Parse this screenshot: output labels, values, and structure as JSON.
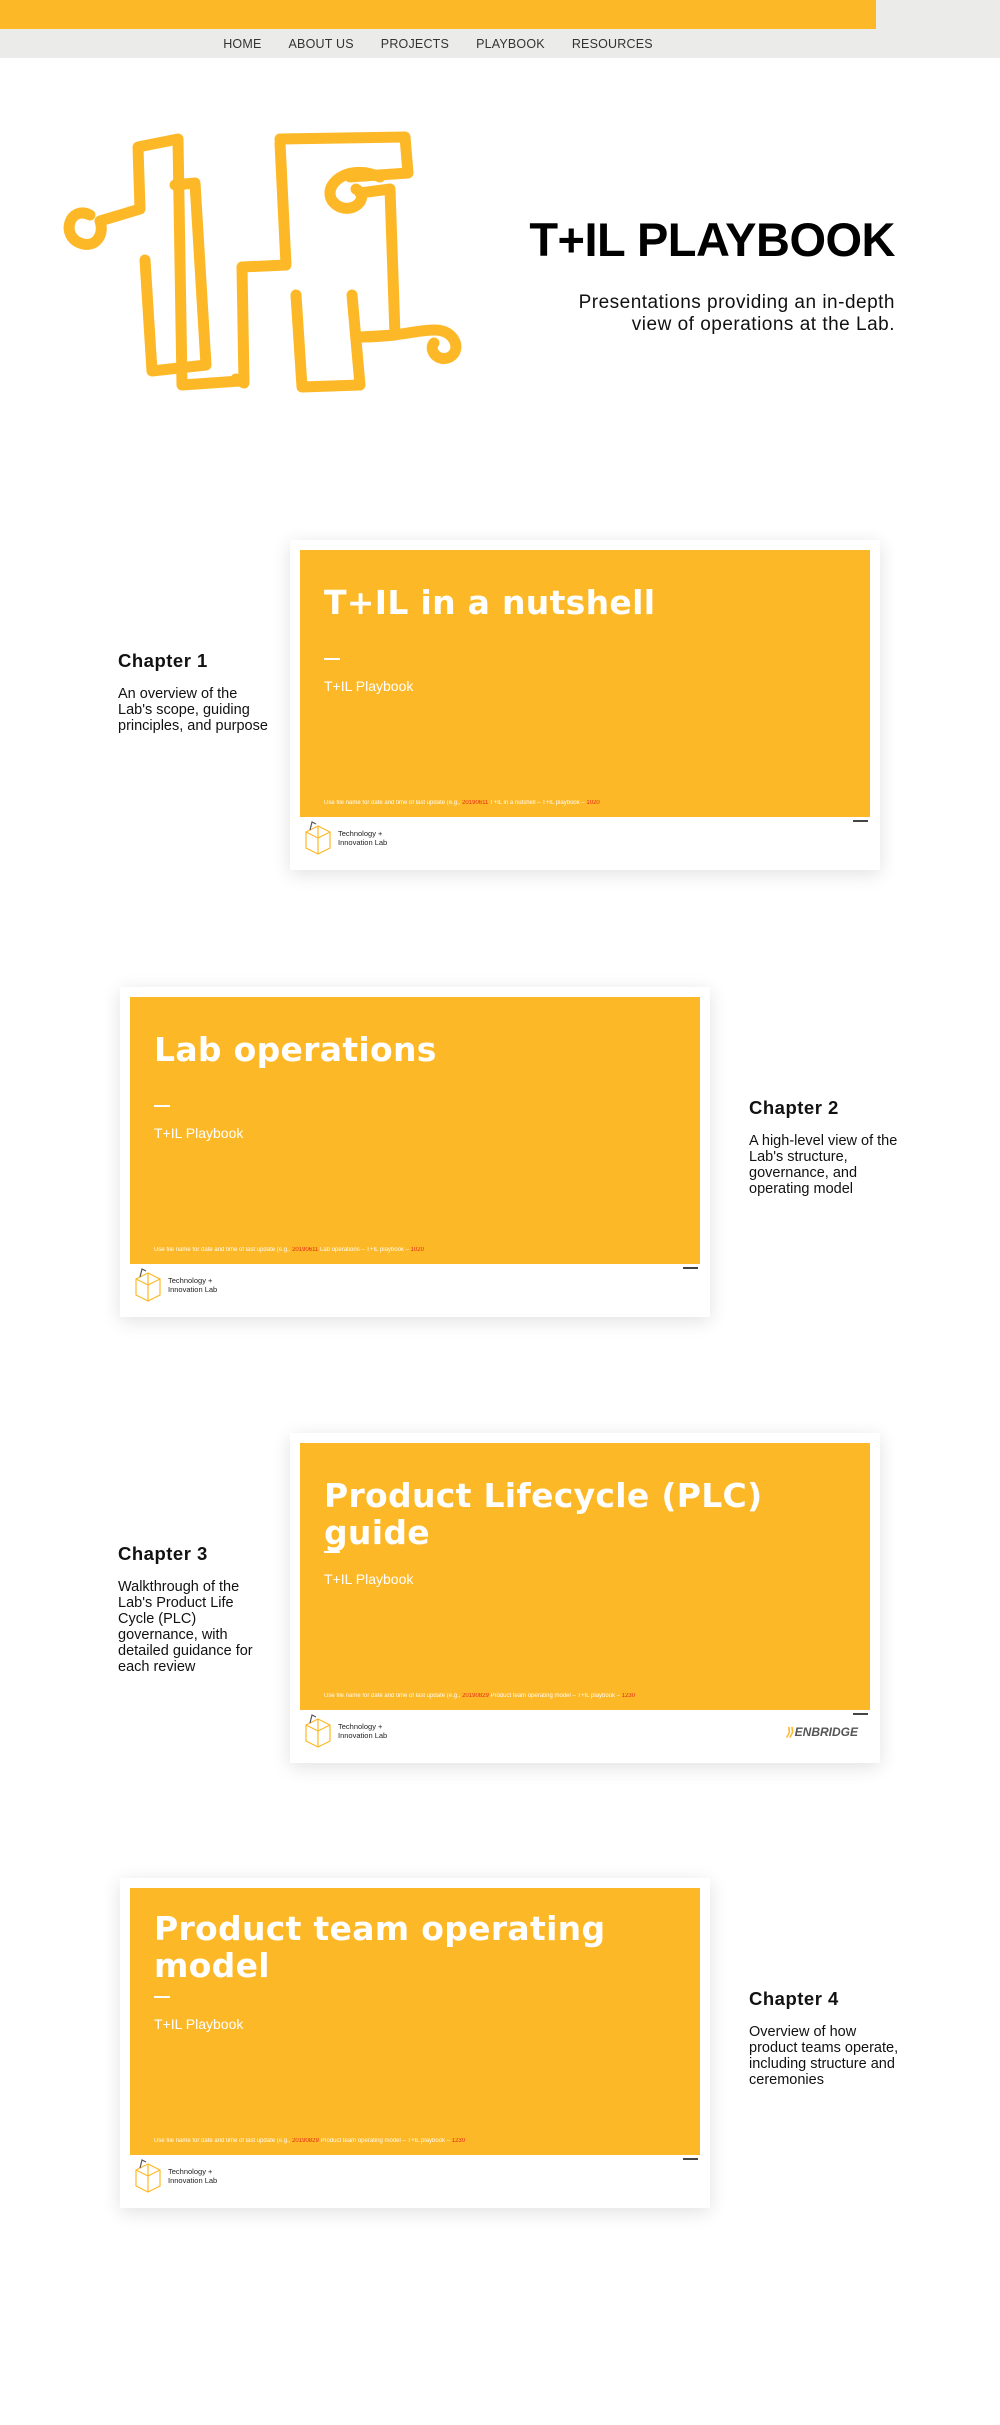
{
  "nav": {
    "items": [
      "HOME",
      "ABOUT US",
      "PROJECTS",
      "PLAYBOOK",
      "RESOURCES"
    ]
  },
  "hero": {
    "title": "T+IL PLAYBOOK",
    "subtitle": "Presentations providing an in-depth view of operations at the Lab."
  },
  "chapters": [
    {
      "label": "Chapter 1",
      "description": "An overview of the Lab's scope, guiding principles, and purpose",
      "slide_title": "T+IL in a nutshell",
      "slide_sub": "T+IL Playbook",
      "foot_prefix": "Use file name for date and time of last update (e.g.,",
      "foot_date": "20190611",
      "foot_mid": "T+IL in a nutshell – T+IL playbook –",
      "foot_time": "1020"
    },
    {
      "label": "Chapter 2",
      "description": "A high-level view of the Lab's structure, governance, and operating model",
      "slide_title": "Lab operations",
      "slide_sub": "T+IL Playbook",
      "foot_prefix": "Use file name for date and time of last update (e.g.,",
      "foot_date": "20190611",
      "foot_mid": "Lab operations – T+IL playbook –",
      "foot_time": "1020"
    },
    {
      "label": "Chapter 3",
      "description": "Walkthrough of the Lab's Product Life Cycle (PLC) governance, with detailed guidance for each review",
      "slide_title": "Product Lifecycle (PLC) guide",
      "slide_sub": "T+IL Playbook",
      "foot_prefix": "Use file name for date and time of last update (e.g.,",
      "foot_date": "20190829",
      "foot_mid": "Product team operating model – T+IL playbook –",
      "foot_time": "1230"
    },
    {
      "label": "Chapter 4",
      "description": "Overview of how product teams operate, including structure and ceremonies",
      "slide_title": "Product team operating model",
      "slide_sub": "T+IL Playbook",
      "foot_prefix": "Use file name for date and time of last update (e.g.,",
      "foot_date": "20190829",
      "foot_mid": "Product team operating model – T+IL playbook –",
      "foot_time": "1230"
    }
  ],
  "lab_logo": {
    "line1": "Technology +",
    "line2": "Innovation Lab"
  },
  "enbridge_logo": "ENBRIDGE",
  "colors": {
    "accent": "#fdb827",
    "nav_bg": "#ebecea",
    "highlight": "#e2231a"
  }
}
